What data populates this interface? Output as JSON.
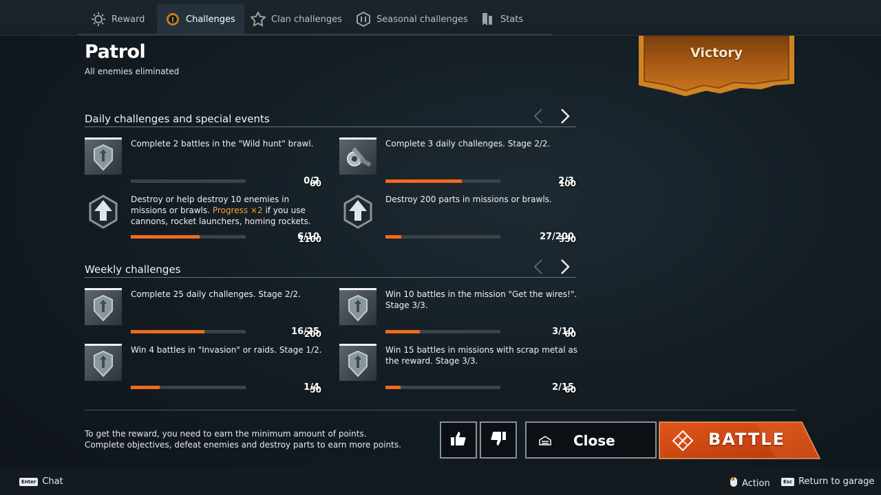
{
  "tabs": [
    {
      "label": "Reward",
      "icon": "reward-icon",
      "active": false
    },
    {
      "label": "Challenges",
      "icon": "challenges-icon",
      "active": true
    },
    {
      "label": "Clan challenges",
      "icon": "clan-icon",
      "active": false
    },
    {
      "label": "Seasonal challenges",
      "icon": "seasonal-icon",
      "active": false
    },
    {
      "label": "Stats",
      "icon": "stats-icon",
      "active": false
    }
  ],
  "mission": {
    "title": "Patrol",
    "subtitle": "All enemies eliminated",
    "result": "Victory"
  },
  "daily": {
    "title": "Daily challenges and special events",
    "items": [
      {
        "desc": "Complete 2 battles in the \"Wild hunt\" brawl.",
        "points": "80",
        "count": "0/2",
        "progress": 0.0,
        "icon": "crest-icon"
      },
      {
        "desc": "Complete 3 daily challenges. Stage 2/2.",
        "points": "100",
        "count": "2/3",
        "progress": 0.667,
        "icon": "cannon-icon"
      },
      {
        "desc_before": "Destroy or help destroy 10 enemies in missions or brawls. ",
        "desc_highlight": "Progress ×2",
        "desc_after": " if you use cannons, rocket launchers, homing rockets.",
        "points": "1100",
        "count": "6/10",
        "progress": 0.6,
        "icon": "upgrade-arrow-icon"
      },
      {
        "desc": "Destroy 200 parts in missions or brawls.",
        "points": "350",
        "count": "27/200",
        "progress": 0.135,
        "icon": "upgrade-arrow-icon"
      }
    ]
  },
  "weekly": {
    "title": "Weekly challenges",
    "items": [
      {
        "desc": "Complete 25 daily challenges.  Stage 2/2.",
        "points": "200",
        "count": "16/25",
        "progress": 0.64,
        "icon": "crest-icon"
      },
      {
        "desc": "Win 10 battles in the mission \"Get the wires!\". Stage 3/3.",
        "points": "60",
        "count": "3/10",
        "progress": 0.3,
        "icon": "crest-icon"
      },
      {
        "desc": "Win 4 battles in \"Invasion\" or raids. Stage 1/2.",
        "points": "50",
        "count": "1/4",
        "progress": 0.25,
        "icon": "crest-icon"
      },
      {
        "desc": "Win 15 battles in missions with scrap metal as the reward. Stage 3/3.",
        "points": "60",
        "count": "2/15",
        "progress": 0.133,
        "icon": "crest-icon"
      }
    ]
  },
  "info": {
    "line1": "To get the reward, you need to earn the minimum amount of points.",
    "line2": "Complete objectives, defeat enemies and destroy parts to earn more points."
  },
  "buttons": {
    "close": "Close",
    "battle": "BATTLE"
  },
  "footer": {
    "chat_key": "Enter",
    "chat_label": "Chat",
    "action_label": "Action",
    "garage_key": "Esc",
    "garage_label": "Return to garage"
  },
  "colors": {
    "accent": "#f06a1c",
    "highlight": "#f0a13a",
    "banner": "#c9741e"
  }
}
